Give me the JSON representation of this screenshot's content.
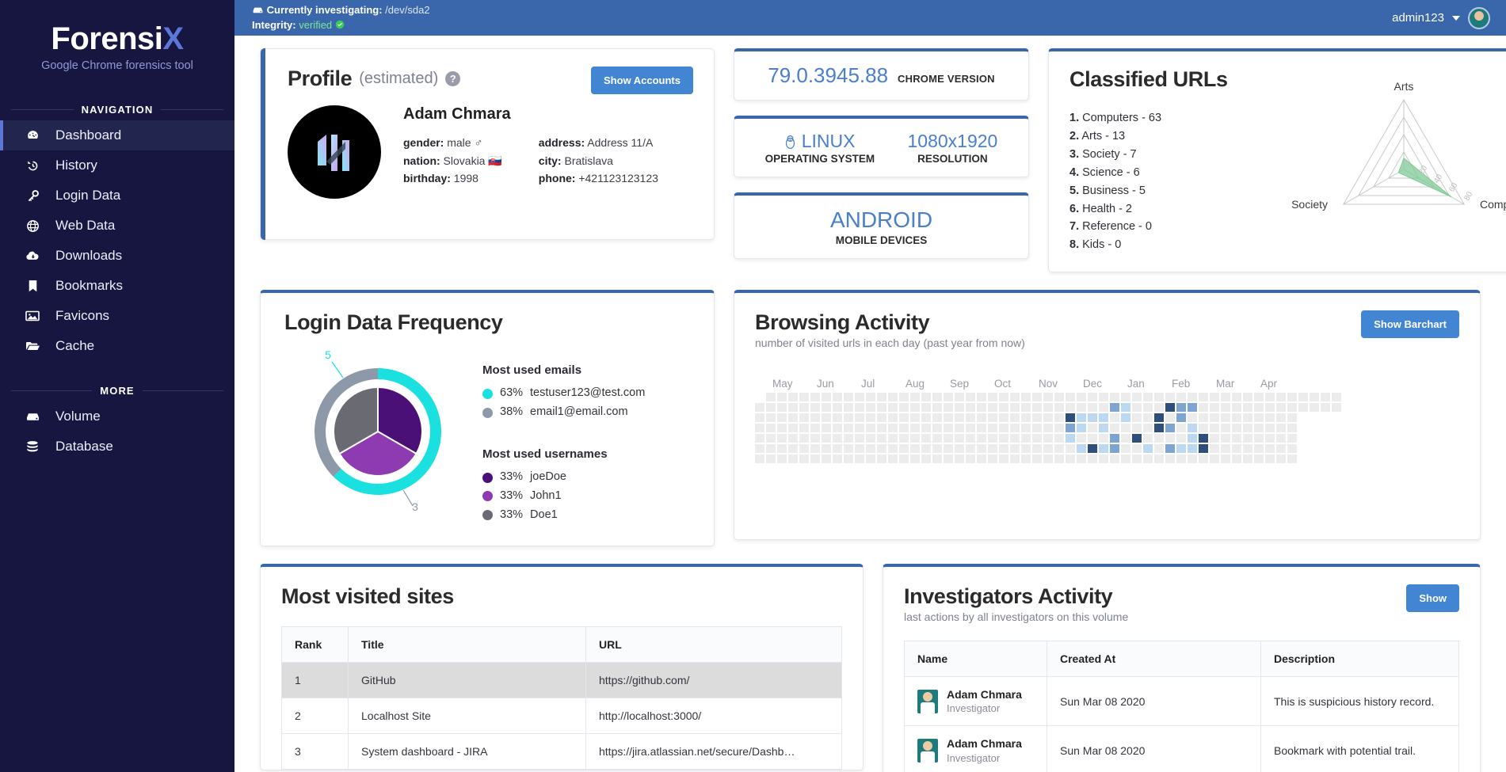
{
  "brand": {
    "name_main": "Forensi",
    "name_accent": "X",
    "subtitle": "Google Chrome forensics tool"
  },
  "sidebar": {
    "section_nav": "NAVIGATION",
    "section_more": "MORE",
    "nav_items": [
      {
        "label": "Dashboard",
        "icon": "gauge-icon",
        "glyph": "◒",
        "active": true
      },
      {
        "label": "History",
        "icon": "history-icon",
        "glyph": "↺",
        "active": false
      },
      {
        "label": "Login Data",
        "icon": "key-icon",
        "glyph": "⚷",
        "active": false
      },
      {
        "label": "Web Data",
        "icon": "globe-icon",
        "glyph": "✇",
        "active": false
      },
      {
        "label": "Downloads",
        "icon": "cloud-download-icon",
        "glyph": "⛃",
        "active": false
      },
      {
        "label": "Bookmarks",
        "icon": "bookmark-icon",
        "glyph": "🔖",
        "active": false
      },
      {
        "label": "Favicons",
        "icon": "image-icon",
        "glyph": "▣",
        "active": false
      },
      {
        "label": "Cache",
        "icon": "folder-open-icon",
        "glyph": "🗀",
        "active": false
      }
    ],
    "more_items": [
      {
        "label": "Volume",
        "icon": "hdd-icon",
        "glyph": "▤"
      },
      {
        "label": "Database",
        "icon": "database-icon",
        "glyph": "≣"
      }
    ]
  },
  "topbar": {
    "investigating_label": "Currently investigating:",
    "investigating_value": "/dev/sda2",
    "integrity_label": "Integrity:",
    "integrity_value": "verified",
    "user": "admin123"
  },
  "profile": {
    "title": "Profile",
    "estimated": "(estimated)",
    "help": "?",
    "show_accounts": "Show Accounts",
    "name": "Adam Chmara",
    "fields_left": [
      {
        "key": "gender:",
        "value": "male ♂"
      },
      {
        "key": "nation:",
        "value": "Slovakia 🇸🇰"
      },
      {
        "key": "birthday:",
        "value": "1998"
      }
    ],
    "fields_right": [
      {
        "key": "address:",
        "value": "Address 11/A"
      },
      {
        "key": "city:",
        "value": "Bratislava"
      },
      {
        "key": "phone:",
        "value": "+421123123123"
      }
    ]
  },
  "stats": {
    "chrome_version_value": "79.0.3945.88",
    "chrome_version_label": "CHROME VERSION",
    "os_value": "LINUX",
    "os_label": "OPERATING SYSTEM",
    "resolution_value": "1080x1920",
    "resolution_label": "RESOLUTION",
    "mobile_value": "ANDROID",
    "mobile_label": "MOBILE DEVICES"
  },
  "classified": {
    "title": "Classified URLs",
    "list": [
      {
        "n": "1.",
        "text": "Computers - 63"
      },
      {
        "n": "2.",
        "text": "Arts - 13"
      },
      {
        "n": "3.",
        "text": "Society - 7"
      },
      {
        "n": "4.",
        "text": "Science - 6"
      },
      {
        "n": "5.",
        "text": "Business - 5"
      },
      {
        "n": "6.",
        "text": "Health - 2"
      },
      {
        "n": "7.",
        "text": "Reference - 0"
      },
      {
        "n": "8.",
        "text": "Kids - 0"
      }
    ]
  },
  "login_freq": {
    "title": "Login Data Frequency",
    "emails_title": "Most used emails",
    "emails": [
      {
        "pct": "63%",
        "label": "testuser123@test.com",
        "color": "#1ae0e0",
        "count": "5"
      },
      {
        "pct": "38%",
        "label": "email1@email.com",
        "color": "#8d98a8",
        "count": "3"
      }
    ],
    "usernames_title": "Most used usernames",
    "usernames": [
      {
        "pct": "33%",
        "label": "joeDoe",
        "color": "#4b0f78"
      },
      {
        "pct": "33%",
        "label": "John1",
        "color": "#8e3ab0"
      },
      {
        "pct": "33%",
        "label": "Doe1",
        "color": "#6a6a73"
      }
    ],
    "outer_labels": [
      "5",
      "3"
    ]
  },
  "browsing": {
    "title": "Browsing Activity",
    "subtitle": "number of visited urls in each day (past year from now)",
    "button": "Show Barchart"
  },
  "most_visited": {
    "title": "Most visited sites",
    "columns": [
      "Rank",
      "Title",
      "URL"
    ],
    "rows": [
      {
        "rank": "1",
        "title": "GitHub",
        "url": "https://github.com/",
        "highlight": true
      },
      {
        "rank": "2",
        "title": "Localhost Site",
        "url": "http://localhost:3000/",
        "highlight": false
      },
      {
        "rank": "3",
        "title": "System dashboard - JIRA",
        "url": "https://jira.atlassian.net/secure/Dashboard.j…",
        "highlight": false
      }
    ]
  },
  "investigators": {
    "title": "Investigators Activity",
    "subtitle": "last actions by all investigators on this volume",
    "button": "Show",
    "columns": [
      "Name",
      "Created At",
      "Description"
    ],
    "rows": [
      {
        "name": "Adam Chmara",
        "role": "Investigator",
        "created": "Sun Mar 08 2020",
        "desc": "This is suspicious history record."
      },
      {
        "name": "Adam Chmara",
        "role": "Investigator",
        "created": "Sun Mar 08 2020",
        "desc": "Bookmark with potential trail."
      }
    ]
  },
  "chart_data": [
    {
      "type": "radar",
      "title": "Classified URLs",
      "categories": [
        "Arts",
        "Computers",
        "Society"
      ],
      "values": [
        13,
        63,
        7
      ],
      "ticks": [
        0,
        20,
        40,
        60,
        80
      ],
      "rmax": 80,
      "fill_color": "#7fcb95",
      "grid": true,
      "legend": "none"
    },
    {
      "type": "pie",
      "title": "Login Data Frequency",
      "rings": [
        {
          "name": "Most used emails",
          "labels": [
            "testuser123@test.com",
            "email1@email.com"
          ],
          "values": [
            63,
            38
          ],
          "counts": [
            5,
            3
          ],
          "colors": [
            "#1ae0e0",
            "#8d98a8"
          ]
        },
        {
          "name": "Most used usernames",
          "labels": [
            "joeDoe",
            "John1",
            "Doe1"
          ],
          "values": [
            33,
            33,
            33
          ],
          "colors": [
            "#4b0f78",
            "#8e3ab0",
            "#6a6a73"
          ]
        }
      ],
      "legend": "right"
    },
    {
      "type": "heatmap",
      "title": "Browsing Activity",
      "subtitle": "number of visited urls in each day (past year from now)",
      "xlabel": "",
      "ylabel": "",
      "month_labels": [
        "May",
        "Jun",
        "Jul",
        "Aug",
        "Sep",
        "Oct",
        "Nov",
        "Dec",
        "Jan",
        "Feb",
        "Mar",
        "Apr"
      ],
      "rows": 7,
      "cols": 53,
      "levels": [
        {
          "level": 0,
          "color": "#ececec"
        },
        {
          "level": 1,
          "color": "#bcd9f1"
        },
        {
          "level": 2,
          "color": "#a8cdea"
        },
        {
          "level": 3,
          "color": "#7ea5d1"
        },
        {
          "level": 4,
          "color": "#2e4f7c"
        }
      ],
      "cells": [
        {
          "row": 1,
          "col": 32,
          "level": 3
        },
        {
          "row": 1,
          "col": 33,
          "level": 1
        },
        {
          "row": 1,
          "col": 37,
          "level": 4
        },
        {
          "row": 1,
          "col": 38,
          "level": 3
        },
        {
          "row": 1,
          "col": 39,
          "level": 3
        },
        {
          "row": 2,
          "col": 28,
          "level": 4
        },
        {
          "row": 2,
          "col": 29,
          "level": 1
        },
        {
          "row": 2,
          "col": 30,
          "level": 1
        },
        {
          "row": 2,
          "col": 31,
          "level": 1
        },
        {
          "row": 2,
          "col": 33,
          "level": 1
        },
        {
          "row": 2,
          "col": 36,
          "level": 4
        },
        {
          "row": 2,
          "col": 38,
          "level": 3
        },
        {
          "row": 3,
          "col": 28,
          "level": 3
        },
        {
          "row": 3,
          "col": 29,
          "level": 1
        },
        {
          "row": 3,
          "col": 31,
          "level": 1
        },
        {
          "row": 3,
          "col": 36,
          "level": 4
        },
        {
          "row": 3,
          "col": 37,
          "level": 3
        },
        {
          "row": 3,
          "col": 39,
          "level": 1
        },
        {
          "row": 4,
          "col": 28,
          "level": 1
        },
        {
          "row": 4,
          "col": 32,
          "level": 3
        },
        {
          "row": 4,
          "col": 34,
          "level": 4
        },
        {
          "row": 4,
          "col": 39,
          "level": 1
        },
        {
          "row": 4,
          "col": 40,
          "level": 4
        },
        {
          "row": 5,
          "col": 29,
          "level": 1
        },
        {
          "row": 5,
          "col": 30,
          "level": 4
        },
        {
          "row": 5,
          "col": 31,
          "level": 1
        },
        {
          "row": 5,
          "col": 32,
          "level": 3
        },
        {
          "row": 5,
          "col": 35,
          "level": 1
        },
        {
          "row": 5,
          "col": 37,
          "level": 3
        },
        {
          "row": 5,
          "col": 38,
          "level": 1
        },
        {
          "row": 5,
          "col": 39,
          "level": 1
        },
        {
          "row": 5,
          "col": 40,
          "level": 4
        }
      ]
    }
  ],
  "colors": {
    "brand_dark": "#161640",
    "brand_accent": "#5b78d8",
    "topbar": "#3a66ab",
    "primary": "#4285d3",
    "ok_green": "#7ce895"
  }
}
